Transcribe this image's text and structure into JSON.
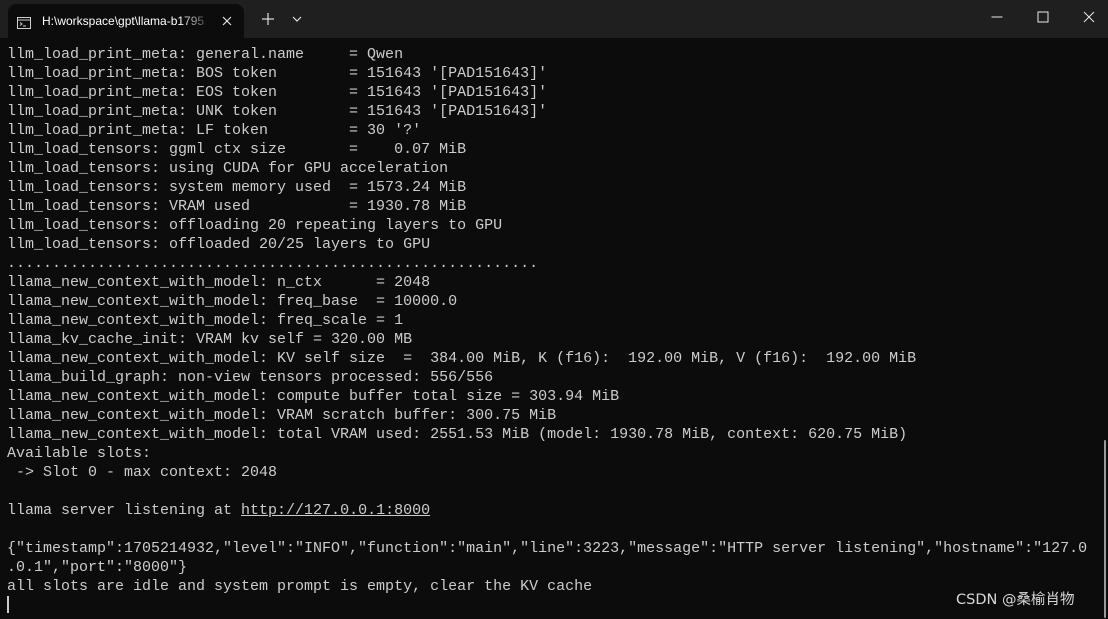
{
  "window": {
    "tab_title": "H:\\workspace\\gpt\\llama-b1795",
    "tab_icon": "terminal-icon",
    "close_tab_icon": "close-icon",
    "new_tab_icon": "plus-icon",
    "dropdown_icon": "chevron-down-icon",
    "minimize_icon": "minimize-icon",
    "maximize_icon": "maximize-icon",
    "close_icon": "close-icon"
  },
  "colors": {
    "background": "#0c0c0c",
    "titlebar": "#1f1f1f",
    "text": "#cccccc",
    "tab_title_text": "#ffffff"
  },
  "terminal": {
    "lines": [
      "llm_load_print_meta: general.name     = Qwen",
      "llm_load_print_meta: BOS token        = 151643 '[PAD151643]'",
      "llm_load_print_meta: EOS token        = 151643 '[PAD151643]'",
      "llm_load_print_meta: UNK token        = 151643 '[PAD151643]'",
      "llm_load_print_meta: LF token         = 30 '?'",
      "llm_load_tensors: ggml ctx size       =    0.07 MiB",
      "llm_load_tensors: using CUDA for GPU acceleration",
      "llm_load_tensors: system memory used  = 1573.24 MiB",
      "llm_load_tensors: VRAM used           = 1930.78 MiB",
      "llm_load_tensors: offloading 20 repeating layers to GPU",
      "llm_load_tensors: offloaded 20/25 layers to GPU",
      "...........................................................",
      "llama_new_context_with_model: n_ctx      = 2048",
      "llama_new_context_with_model: freq_base  = 10000.0",
      "llama_new_context_with_model: freq_scale = 1",
      "llama_kv_cache_init: VRAM kv self = 320.00 MB",
      "llama_new_context_with_model: KV self size  =  384.00 MiB, K (f16):  192.00 MiB, V (f16):  192.00 MiB",
      "llama_build_graph: non-view tensors processed: 556/556",
      "llama_new_context_with_model: compute buffer total size = 303.94 MiB",
      "llama_new_context_with_model: VRAM scratch buffer: 300.75 MiB",
      "llama_new_context_with_model: total VRAM used: 2551.53 MiB (model: 1930.78 MiB, context: 620.75 MiB)",
      "Available slots:",
      " -> Slot 0 - max context: 2048",
      "",
      "",
      "",
      "{\"timestamp\":1705214932,\"level\":\"INFO\",\"function\":\"main\",\"line\":3223,\"message\":\"HTTP server listening\",\"hostname\":\"127.0",
      ".0.1\",\"port\":\"8000\"}",
      "all slots are idle and system prompt is empty, clear the KV cache"
    ],
    "server_line_prefix": "llama server listening at ",
    "server_url": "http://127.0.0.1:8000"
  },
  "watermark": "CSDN @桑榆肖物"
}
